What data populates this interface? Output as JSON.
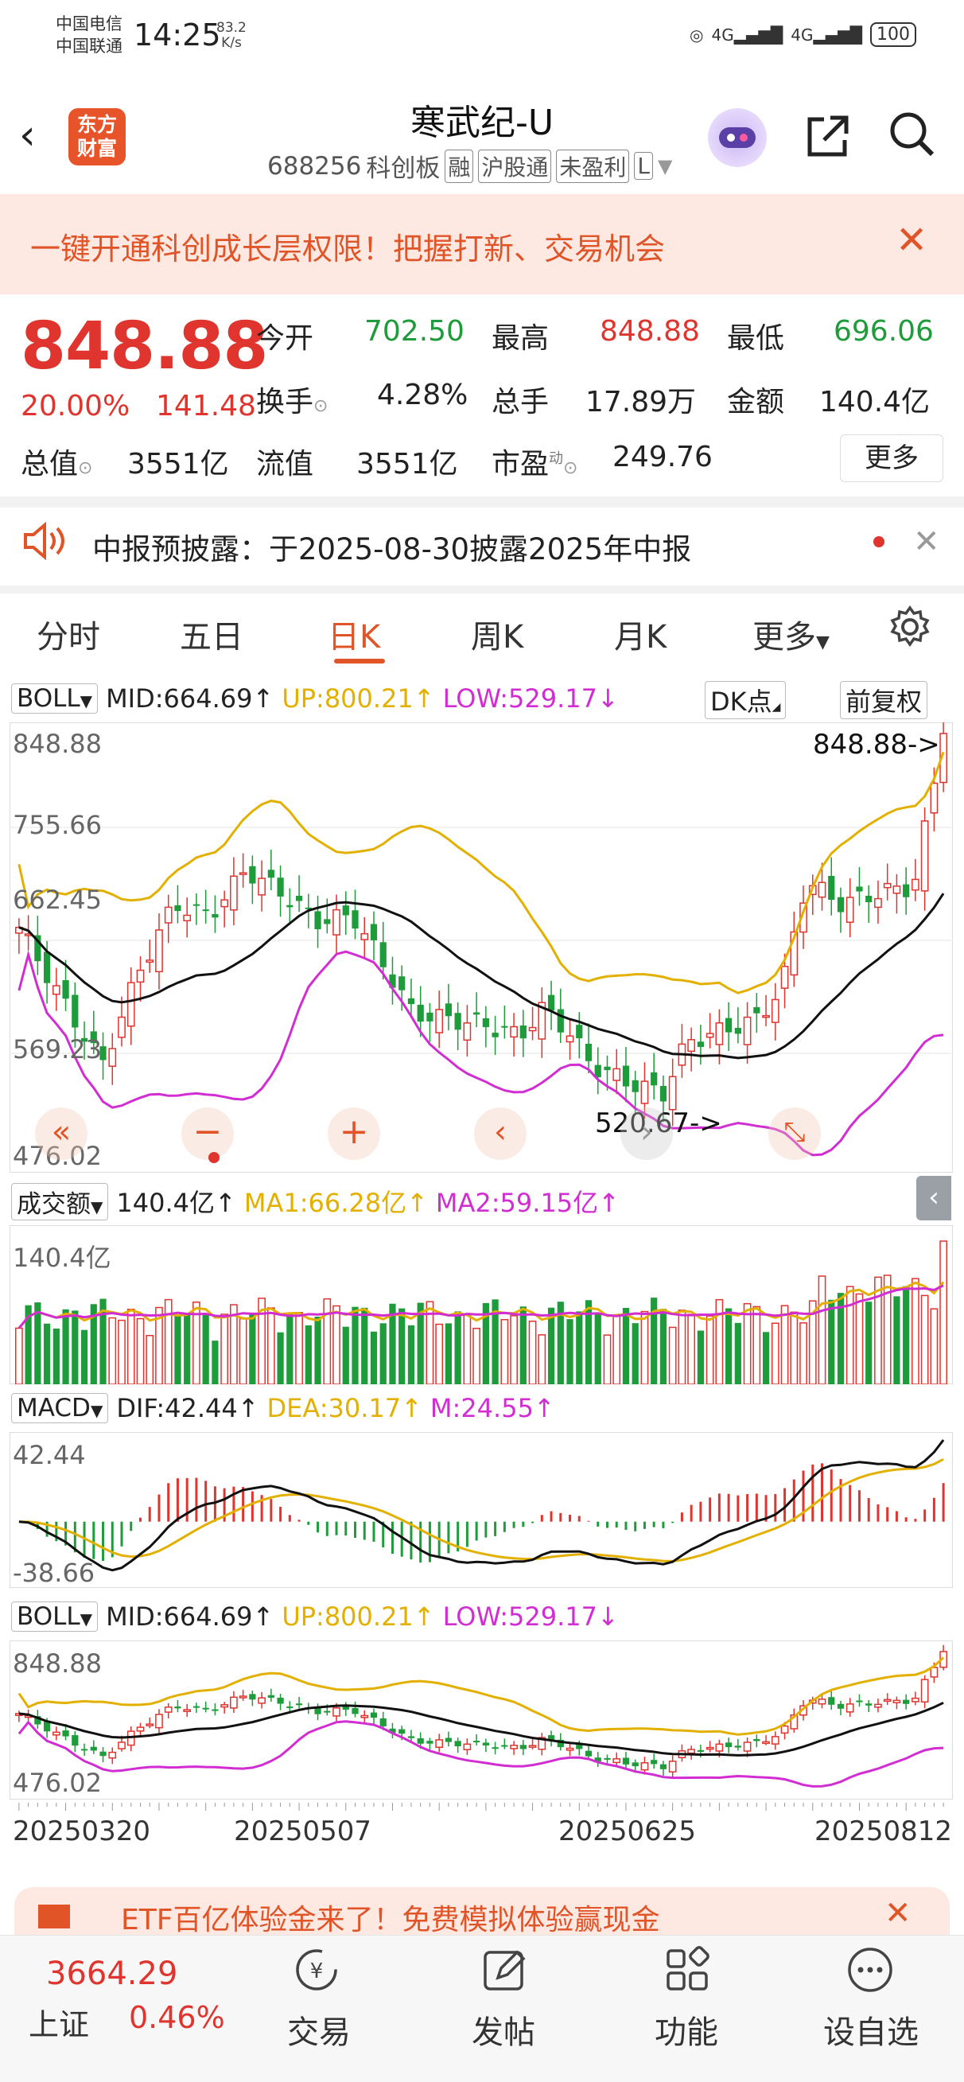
{
  "status": {
    "carrier1": "中国电信",
    "carrier2": "中国联通",
    "time": "14:25",
    "speed_value": "83.2",
    "speed_unit": "K/s",
    "signal1": "4G",
    "signal2": "4G",
    "battery": "100"
  },
  "header": {
    "logo_line1": "东方",
    "logo_line2": "财富",
    "title": "寒武纪-U",
    "code": "688256",
    "tags": [
      "科创板",
      "融",
      "沪股通",
      "未盈利",
      "L"
    ]
  },
  "banner": {
    "text": "一键开通科创成长层权限！把握打新、交易机会"
  },
  "quote": {
    "price": "848.88",
    "change_pct": "20.00%",
    "change": "141.48",
    "open_label": "今开",
    "open": "702.50",
    "high_label": "最高",
    "high": "848.88",
    "low_label": "最低",
    "low": "696.06",
    "turnover_label": "换手",
    "turnover": "4.28%",
    "volume_label": "总手",
    "volume": "17.89万",
    "amount_label": "金额",
    "amount": "140.4亿",
    "mktcap_label": "总值",
    "mktcap": "3551亿",
    "float_label": "流值",
    "float": "3551亿",
    "pe_label": "市盈",
    "pe_sup": "动",
    "pe": "249.76",
    "more": "更多"
  },
  "notice": {
    "text": "中报预披露：于2025-08-30披露2025年中报"
  },
  "tabs": [
    "分时",
    "五日",
    "日K",
    "周K",
    "月K",
    "更多"
  ],
  "active_tab": "日K",
  "kchart": {
    "indicator": "BOLL",
    "mid": "MID:664.69↑",
    "up": "UP:800.21↑",
    "low": "LOW:529.17↓",
    "dk": "DK点",
    "adjust": "前复权",
    "y_labels": [
      "848.88",
      "755.66",
      "662.45",
      "569.23",
      "476.02"
    ],
    "high_marker": "848.88->",
    "low_marker": "520.67->"
  },
  "volume": {
    "indicator": "成交额",
    "value": "140.4亿↑",
    "ma1": "MA1:66.28亿↑",
    "ma2": "MA2:59.15亿↑",
    "y_label": "140.4亿"
  },
  "macd": {
    "indicator": "MACD",
    "dif": "DIF:42.44↑",
    "dea": "DEA:30.17↑",
    "m": "M:24.55↑",
    "y_top": "42.44",
    "y_bottom": "-38.66"
  },
  "boll2": {
    "indicator": "BOLL",
    "mid": "MID:664.69↑",
    "up": "UP:800.21↑",
    "low": "LOW:529.17↓",
    "y_top": "848.88",
    "y_bottom": "476.02"
  },
  "x_dates": [
    "20250320",
    "20250507",
    "20250625",
    "20250812"
  ],
  "ad": {
    "text": "ETF百亿体验金来了！免费模拟体验赢现金"
  },
  "bottom": {
    "index_value": "3664.29",
    "index_name": "上证",
    "index_pct": "0.46%",
    "nav": [
      "交易",
      "发帖",
      "功能",
      "设自选"
    ]
  },
  "colors": {
    "up": "#e0342e",
    "down": "#1e9b3a",
    "accent": "#e05428",
    "boll_up": "#e3b000",
    "boll_low": "#d22dd2",
    "boll_mid": "#111111"
  }
}
